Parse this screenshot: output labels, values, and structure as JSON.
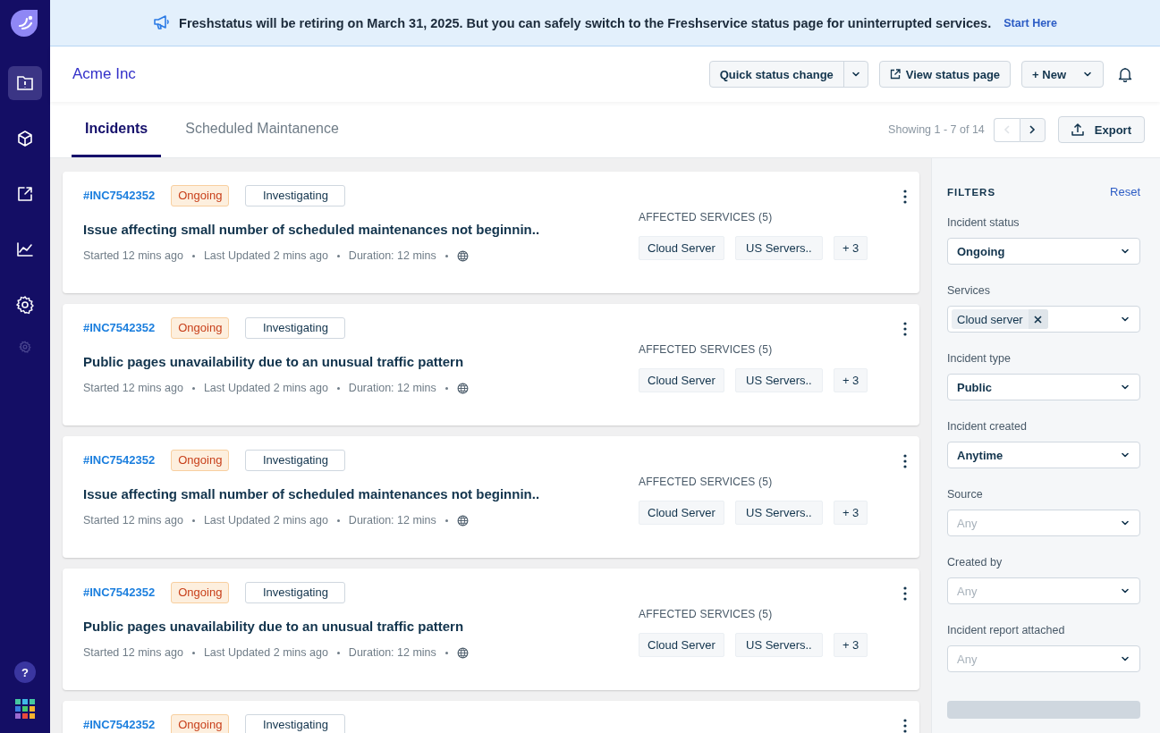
{
  "sidebar": {
    "items": [
      {
        "kind": "incident",
        "selected": true
      },
      {
        "kind": "box",
        "selected": false
      },
      {
        "kind": "export",
        "selected": false
      },
      {
        "kind": "chart",
        "selected": false
      },
      {
        "kind": "gear",
        "selected": false
      },
      {
        "kind": "gear-small",
        "selected": false
      }
    ],
    "help": "?"
  },
  "banner": {
    "text": "Freshstatus will be retiring on March 31, 2025. But you can safely switch to the Freshservice status page for uninterrupted services.",
    "link": "Start Here"
  },
  "header": {
    "title": "Acme Inc",
    "quick_status": "Quick status change",
    "view_status": "View status page",
    "new": "+ New"
  },
  "tabs": [
    {
      "label": "Incidents",
      "selected": true
    },
    {
      "label": "Scheduled Maintanence",
      "selected": false
    }
  ],
  "pagination": {
    "text": "Showing 1 - 7 of 14",
    "prev_disabled": true
  },
  "export": "Export",
  "incidents": [
    {
      "id": "#INC7542352",
      "status": "Ongoing",
      "stage": "Investigating",
      "title": "Issue affecting small number of scheduled maintenances not beginnin..",
      "meta": [
        "Started 12 mins ago",
        "Last Updated 2 mins ago",
        "Duration: 12 mins"
      ],
      "affected_label": "AFFECTED SERVICES (5)",
      "services": [
        "Cloud Server",
        "US Servers..",
        "+ 3"
      ]
    },
    {
      "id": "#INC7542352",
      "status": "Ongoing",
      "stage": "Investigating",
      "title": "Public pages unavailability due to an unusual traffic pattern",
      "meta": [
        "Started 12 mins ago",
        "Last Updated 2 mins ago",
        "Duration: 12 mins"
      ],
      "affected_label": "AFFECTED SERVICES (5)",
      "services": [
        "Cloud Server",
        "US Servers..",
        "+ 3"
      ]
    },
    {
      "id": "#INC7542352",
      "status": "Ongoing",
      "stage": "Investigating",
      "title": "Issue affecting small number of scheduled maintenances not beginnin..",
      "meta": [
        "Started 12 mins ago",
        "Last Updated 2 mins ago",
        "Duration: 12 mins"
      ],
      "affected_label": "AFFECTED SERVICES (5)",
      "services": [
        "Cloud Server",
        "US Servers..",
        "+ 3"
      ]
    },
    {
      "id": "#INC7542352",
      "status": "Ongoing",
      "stage": "Investigating",
      "title": "Public pages unavailability due to an unusual traffic pattern",
      "meta": [
        "Started 12 mins ago",
        "Last Updated 2 mins ago",
        "Duration: 12 mins"
      ],
      "affected_label": "AFFECTED SERVICES (5)",
      "services": [
        "Cloud Server",
        "US Servers..",
        "+ 3"
      ]
    },
    {
      "id": "#INC7542352",
      "status": "Ongoing",
      "stage": "Investigating"
    }
  ],
  "filters": {
    "title": "FILTERS",
    "reset": "Reset",
    "fields": [
      {
        "label": "Incident status",
        "kind": "value",
        "value": "Ongoing"
      },
      {
        "label": "Services",
        "kind": "tag",
        "value": "Cloud server"
      },
      {
        "label": "Incident type",
        "kind": "value",
        "value": "Public"
      },
      {
        "label": "Incident created",
        "kind": "value",
        "value": "Anytime"
      },
      {
        "label": "Source",
        "kind": "placeholder",
        "placeholder": "Any"
      },
      {
        "label": "Created by",
        "kind": "placeholder",
        "placeholder": "Any"
      },
      {
        "label": "Incident report attached",
        "kind": "placeholder",
        "placeholder": "Any"
      }
    ]
  }
}
